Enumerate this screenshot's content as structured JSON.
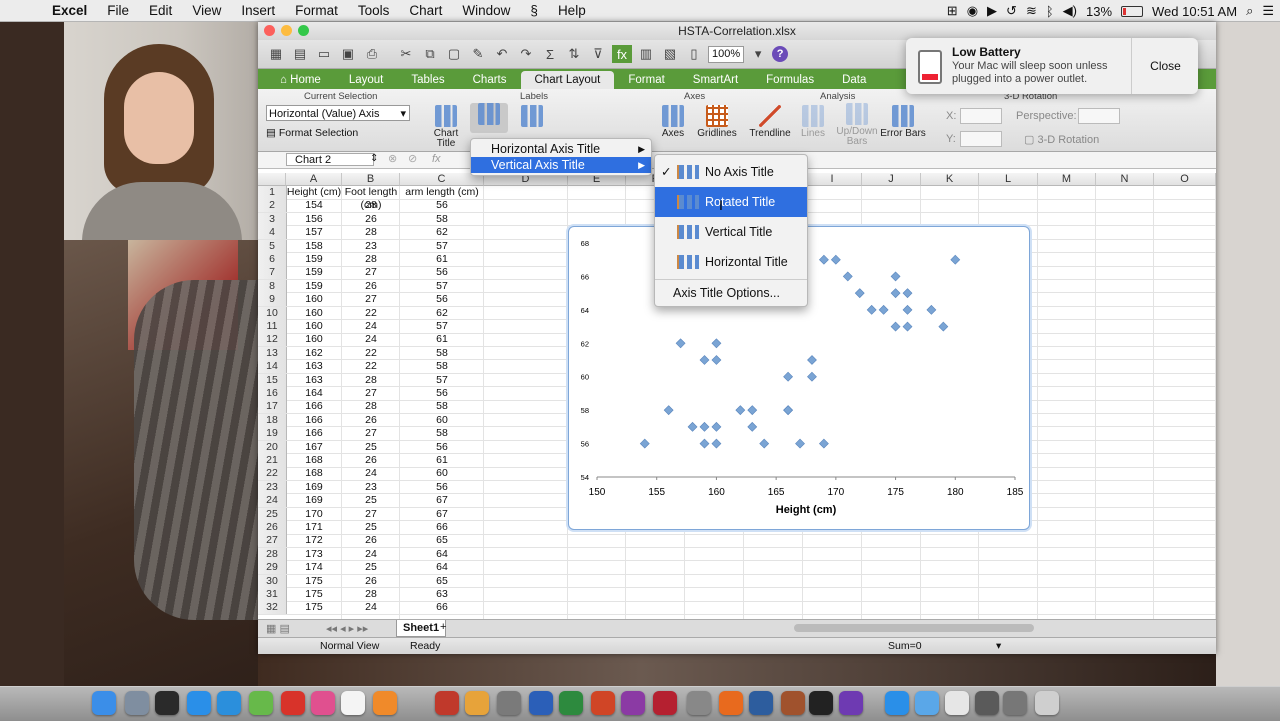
{
  "menubar": {
    "app": "Excel",
    "items": [
      "File",
      "Edit",
      "View",
      "Insert",
      "Format",
      "Tools",
      "Chart",
      "Window",
      "Help"
    ],
    "battery": "13%",
    "clock": "Wed 10:51 AM"
  },
  "window": {
    "title": "HSTA-Correlation.xlsx",
    "zoom": "100%",
    "ribbon_tabs": [
      "Home",
      "Layout",
      "Tables",
      "Charts",
      "Chart Layout",
      "Format",
      "SmartArt",
      "Formulas",
      "Data"
    ],
    "active_tab": "Chart Layout",
    "groups": {
      "current_selection": "Current Selection",
      "labels": "Labels",
      "axes": "Axes",
      "analysis": "Analysis",
      "rotation": "3-D Rotation"
    },
    "current_selection_value": "Horizontal (Value) Axis",
    "format_selection": "Format Selection",
    "buttons": {
      "chart_title": "Chart Title",
      "axes": "Axes",
      "gridlines": "Gridlines",
      "trendline": "Trendline",
      "lines": "Lines",
      "updown": "Up/Down Bars",
      "errorbars": "Error Bars"
    },
    "rotation": {
      "x": "X:",
      "y": "Y:",
      "perspective": "Perspective:",
      "rot3d": "3-D Rotation"
    },
    "name_box": "Chart 2",
    "fx": "fx"
  },
  "grid": {
    "columns": [
      "A",
      "B",
      "C",
      "D",
      "E",
      "F",
      "G",
      "H",
      "I",
      "J",
      "K",
      "L",
      "M",
      "N",
      "O"
    ],
    "headers": [
      "Height (cm)",
      "Foot length (cm)",
      "arm length (cm)"
    ],
    "rows": [
      [
        "154",
        "28",
        "56"
      ],
      [
        "156",
        "26",
        "58"
      ],
      [
        "157",
        "28",
        "62"
      ],
      [
        "158",
        "23",
        "57"
      ],
      [
        "159",
        "28",
        "61"
      ],
      [
        "159",
        "27",
        "56"
      ],
      [
        "159",
        "26",
        "57"
      ],
      [
        "160",
        "27",
        "56"
      ],
      [
        "160",
        "22",
        "62"
      ],
      [
        "160",
        "24",
        "57"
      ],
      [
        "160",
        "24",
        "61"
      ],
      [
        "162",
        "22",
        "58"
      ],
      [
        "163",
        "22",
        "58"
      ],
      [
        "163",
        "28",
        "57"
      ],
      [
        "164",
        "27",
        "56"
      ],
      [
        "166",
        "28",
        "58"
      ],
      [
        "166",
        "26",
        "60"
      ],
      [
        "166",
        "27",
        "58"
      ],
      [
        "167",
        "25",
        "56"
      ],
      [
        "168",
        "26",
        "61"
      ],
      [
        "168",
        "24",
        "60"
      ],
      [
        "169",
        "23",
        "56"
      ],
      [
        "169",
        "25",
        "67"
      ],
      [
        "170",
        "27",
        "67"
      ],
      [
        "171",
        "25",
        "66"
      ],
      [
        "172",
        "26",
        "65"
      ],
      [
        "173",
        "24",
        "64"
      ],
      [
        "174",
        "25",
        "64"
      ],
      [
        "175",
        "26",
        "65"
      ],
      [
        "175",
        "28",
        "63"
      ],
      [
        "175",
        "24",
        "66"
      ]
    ]
  },
  "chart_data": {
    "type": "scatter",
    "xlabel": "Height (cm)",
    "x_ticks": [
      150,
      155,
      160,
      165,
      170,
      175,
      180,
      185
    ],
    "y_ticks": [
      54,
      56,
      58,
      60,
      62,
      64,
      66,
      68
    ],
    "xlim": [
      150,
      185
    ],
    "ylim": [
      54,
      68
    ],
    "points": [
      [
        154,
        56
      ],
      [
        156,
        58
      ],
      [
        157,
        62
      ],
      [
        158,
        57
      ],
      [
        159,
        61
      ],
      [
        159,
        56
      ],
      [
        159,
        57
      ],
      [
        160,
        56
      ],
      [
        160,
        62
      ],
      [
        160,
        57
      ],
      [
        160,
        61
      ],
      [
        162,
        58
      ],
      [
        163,
        58
      ],
      [
        163,
        57
      ],
      [
        164,
        56
      ],
      [
        166,
        58
      ],
      [
        166,
        60
      ],
      [
        166,
        58
      ],
      [
        167,
        56
      ],
      [
        168,
        61
      ],
      [
        168,
        60
      ],
      [
        169,
        56
      ],
      [
        169,
        67
      ],
      [
        170,
        67
      ],
      [
        171,
        66
      ],
      [
        172,
        65
      ],
      [
        173,
        64
      ],
      [
        174,
        64
      ],
      [
        175,
        65
      ],
      [
        175,
        63
      ],
      [
        175,
        66
      ],
      [
        176,
        65
      ],
      [
        176,
        64
      ],
      [
        176,
        63
      ],
      [
        178,
        64
      ],
      [
        179,
        63
      ],
      [
        180,
        67
      ]
    ],
    "marker_color": "#7aa4d4"
  },
  "menus": {
    "axis_title_menu": [
      "Horizontal Axis Title",
      "Vertical Axis Title"
    ],
    "highlighted": "Vertical Axis Title",
    "vertical_submenu": [
      "No Axis Title",
      "Rotated Title",
      "Vertical Title",
      "Horizontal Title"
    ],
    "submenu_checked": "No Axis Title",
    "submenu_highlighted": "Rotated Title",
    "options": "Axis Title Options..."
  },
  "sheet": {
    "tab": "Sheet1",
    "add": "+"
  },
  "status": {
    "view": "Normal View",
    "state": "Ready",
    "sum": "Sum=0"
  },
  "notification": {
    "title": "Low Battery",
    "message": "Your Mac will sleep soon unless plugged into a power outlet.",
    "close": "Close"
  }
}
